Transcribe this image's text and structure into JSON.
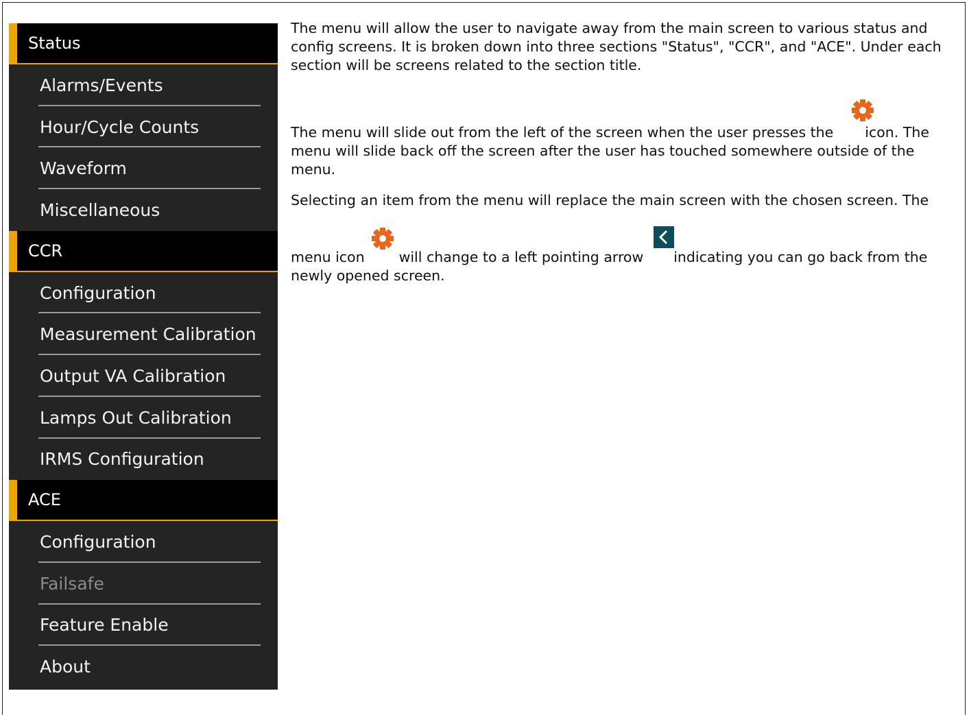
{
  "menu": {
    "sections": [
      {
        "title": "Status",
        "items": [
          {
            "label": "Alarms/Events",
            "enabled": true
          },
          {
            "label": "Hour/Cycle Counts",
            "enabled": true
          },
          {
            "label": "Waveform",
            "enabled": true
          },
          {
            "label": "Miscellaneous",
            "enabled": true
          }
        ]
      },
      {
        "title": "CCR",
        "items": [
          {
            "label": "Configuration",
            "enabled": true
          },
          {
            "label": "Measurement Calibration",
            "enabled": true
          },
          {
            "label": "Output VA Calibration",
            "enabled": true
          },
          {
            "label": "Lamps Out Calibration",
            "enabled": true
          },
          {
            "label": "IRMS Configuration",
            "enabled": true
          }
        ]
      },
      {
        "title": "ACE",
        "items": [
          {
            "label": "Configuration",
            "enabled": true
          },
          {
            "label": "Failsafe",
            "enabled": false
          },
          {
            "label": "Feature Enable",
            "enabled": true
          },
          {
            "label": "About",
            "enabled": true
          }
        ]
      }
    ],
    "colors": {
      "accent": "#f0a400",
      "panel": "#242424",
      "header": "#000000",
      "disabled_text": "#8a8a8a"
    }
  },
  "description": {
    "p1": "The menu will allow the user to navigate away from the main screen to various status and config screens. It is broken down into three sections \"Status\", \"CCR\", and \"ACE\". Under each section will be screens related to the section title.",
    "p2_before": "The menu will slide out from the left of the screen when the user presses the",
    "p2_after": "icon. The menu will slide back off the screen after the user has touched somewhere outside of the menu.",
    "p3": "Selecting an item from the menu will replace the main screen with the chosen screen. The",
    "p4_a": "menu icon",
    "p4_b": "will change to a left pointing arrow",
    "p4_c": "indicating you can go back from the newly opened screen.",
    "icons": {
      "gear": "gear-icon",
      "back": "chevron-left-icon"
    },
    "colors": {
      "gear": "#e8651a",
      "back_bg": "#0e4d5c"
    }
  }
}
